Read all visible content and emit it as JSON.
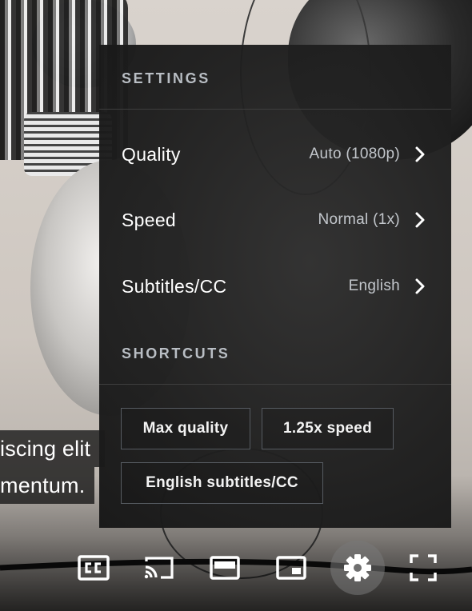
{
  "settings_panel": {
    "header": "SETTINGS",
    "rows": [
      {
        "label": "Quality",
        "value": "Auto (1080p)"
      },
      {
        "label": "Speed",
        "value": "Normal (1x)"
      },
      {
        "label": "Subtitles/CC",
        "value": "English"
      }
    ],
    "shortcuts_header": "SHORTCUTS",
    "shortcuts": [
      "Max quality",
      "1.25x speed",
      "English subtitles/CC"
    ]
  },
  "captions": {
    "line1": "iscing elit",
    "line2": "mentum."
  },
  "controls": {
    "icons": [
      "closed-captions-icon",
      "cast-icon",
      "theater-mode-icon",
      "miniplayer-icon",
      "settings-gear-icon",
      "fullscreen-icon"
    ],
    "active": "settings-gear-icon"
  },
  "colors": {
    "panel_bg": "#1e1e1e",
    "header_text": "#b9bec4",
    "chip_border": "#565b61",
    "gear_active_bg": "#787878"
  }
}
